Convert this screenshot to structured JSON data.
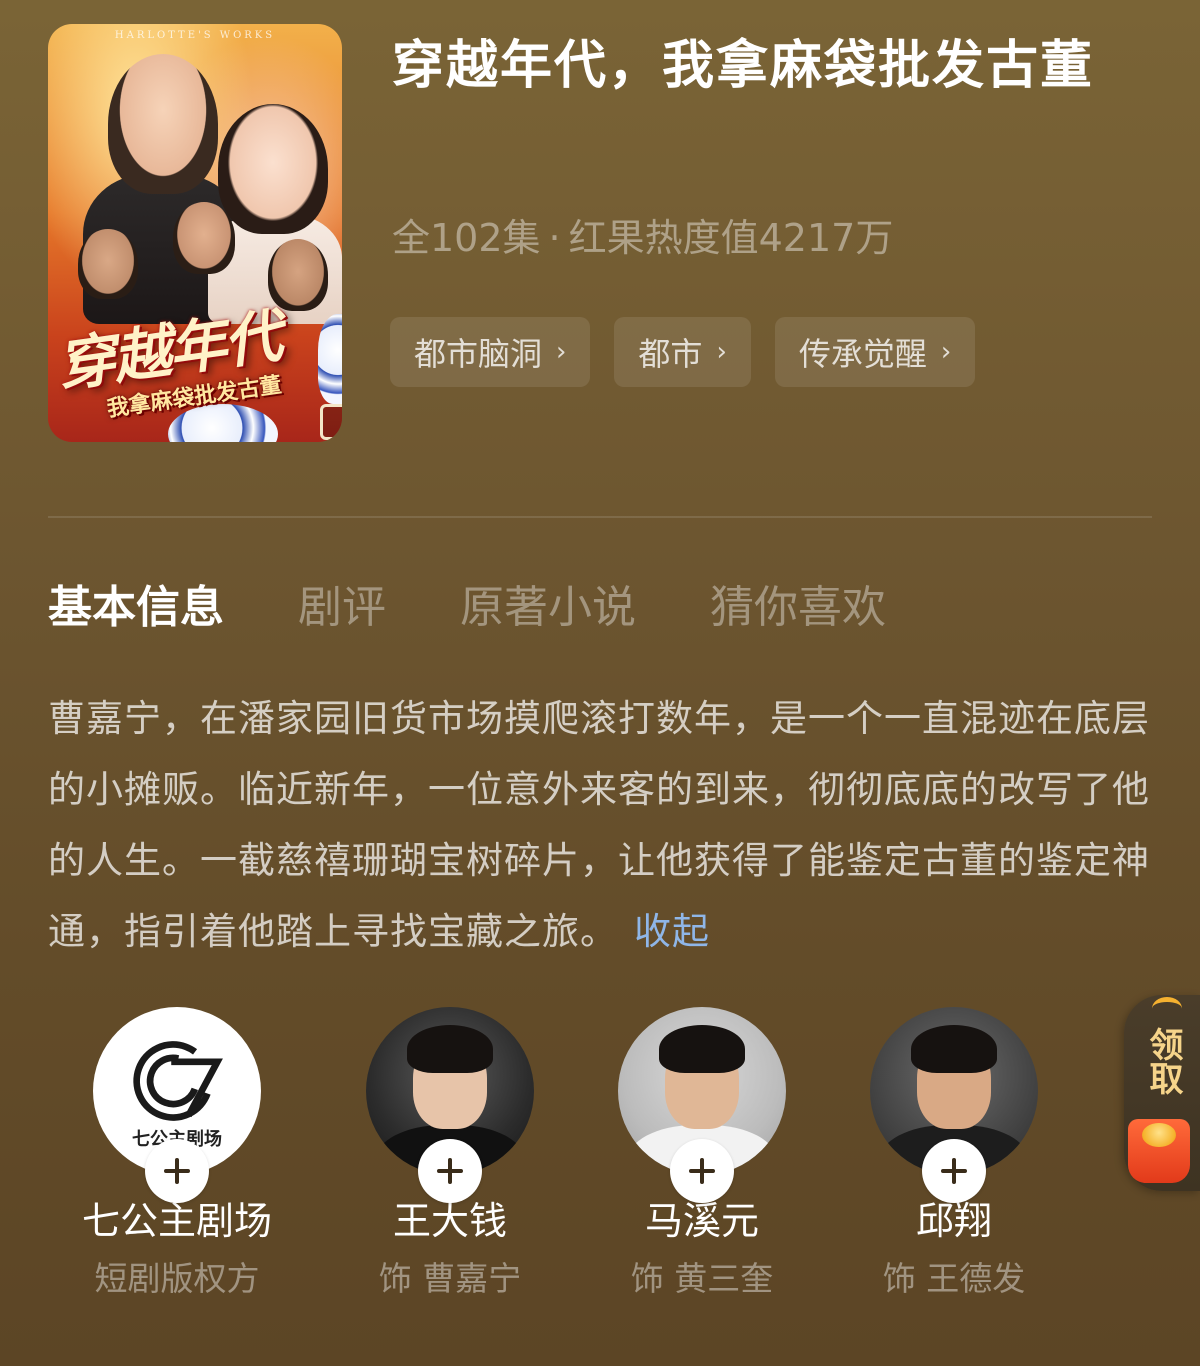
{
  "drama": {
    "title": "穿越年代，我拿麻袋批发古董",
    "episodes": "全102集",
    "separator": "·",
    "heat": "红果热度值4217万",
    "poster": {
      "title_main": "穿越年代",
      "title_sub": "我拿麻袋批发古董",
      "top_text": "HARLOTTE'S WORKS"
    }
  },
  "tags": [
    {
      "label": "都市脑洞"
    },
    {
      "label": "都市"
    },
    {
      "label": "传承觉醒"
    }
  ],
  "tabs": [
    {
      "label": "基本信息",
      "active": true
    },
    {
      "label": "剧评",
      "active": false
    },
    {
      "label": "原著小说",
      "active": false
    },
    {
      "label": "猜你喜欢",
      "active": false
    }
  ],
  "synopsis": {
    "text": "曹嘉宁，在潘家园旧货市场摸爬滚打数年，是一个一直混迹在底层的小摊贩。临近新年，一位意外来客的到来，彻彻底底的改写了他的人生。一截慈禧珊瑚宝树碎片，让他获得了能鉴定古董的鉴定神通，指引着他踏上寻找宝藏之旅。",
    "collapse_label": "收起"
  },
  "cast": [
    {
      "name": "七公主剧场",
      "role": "短剧版权方",
      "logo_text": "七公主剧场"
    },
    {
      "name": "王大钱",
      "role": "饰 曹嘉宁"
    },
    {
      "name": "马溪元",
      "role": "饰 黄三奎"
    },
    {
      "name": "邱翔",
      "role": "饰 王德发"
    }
  ],
  "reward": {
    "label": "领取"
  },
  "colors": {
    "accent_link": "#8fb6e8",
    "reward_text": "#f6d48a",
    "envelope": "#e23a1a"
  }
}
